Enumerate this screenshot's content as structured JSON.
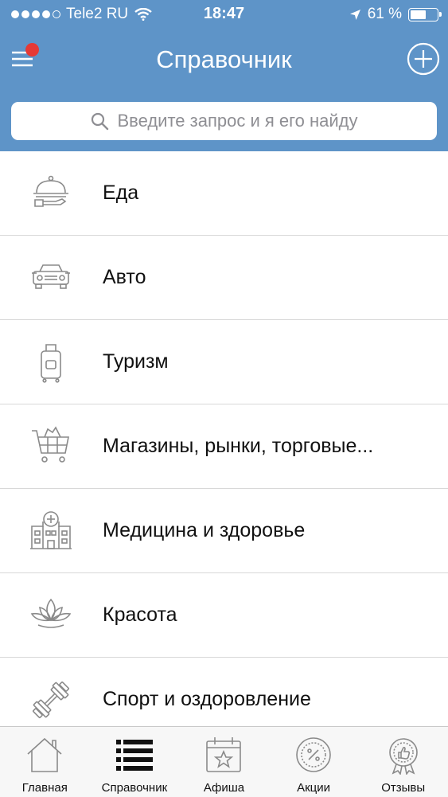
{
  "status_bar": {
    "carrier": "Tele2 RU",
    "time": "18:47",
    "battery_percent": "61 %",
    "battery_level": 0.61,
    "signal_bars_filled": 4
  },
  "header": {
    "title": "Справочник",
    "has_notification": true
  },
  "search": {
    "placeholder": "Введите запрос и я его найду"
  },
  "categories": [
    {
      "label": "Еда",
      "icon": "food-cloche-icon"
    },
    {
      "label": "Авто",
      "icon": "car-icon"
    },
    {
      "label": "Туризм",
      "icon": "suitcase-icon"
    },
    {
      "label": "Магазины, рынки, торговые...",
      "icon": "shopping-cart-icon"
    },
    {
      "label": "Медицина и здоровье",
      "icon": "hospital-icon"
    },
    {
      "label": "Красота",
      "icon": "lotus-icon"
    },
    {
      "label": "Спорт и оздоровление",
      "icon": "dumbbell-icon"
    }
  ],
  "tabs": [
    {
      "label": "Главная",
      "icon": "home-icon",
      "active": false
    },
    {
      "label": "Справочник",
      "icon": "list-icon",
      "active": true
    },
    {
      "label": "Афиша",
      "icon": "calendar-star-icon",
      "active": false
    },
    {
      "label": "Акции",
      "icon": "percent-badge-icon",
      "active": false
    },
    {
      "label": "Отзывы",
      "icon": "thumbs-up-badge-icon",
      "active": false
    }
  ],
  "colors": {
    "header_blue": "#5e94c8",
    "notification_red": "#e53935",
    "icon_gray": "#8a8a8a",
    "divider": "#d8d8d8"
  }
}
